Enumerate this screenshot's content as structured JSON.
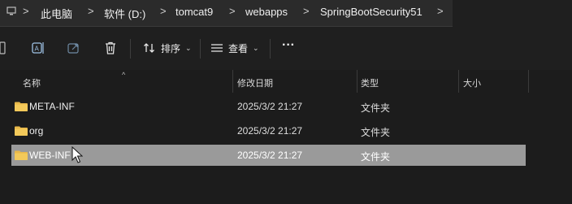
{
  "address": {
    "crumbs": [
      "此电脑",
      "软件 (D:)",
      "tomcat9",
      "webapps",
      "SpringBootSecurity51"
    ],
    "separator": ">"
  },
  "toolbar": {
    "sort_label": "排序",
    "view_label": "查看",
    "more_label": "···"
  },
  "columns": {
    "name": "名称",
    "modified": "修改日期",
    "type": "类型",
    "size": "大小"
  },
  "rows": [
    {
      "name": "META-INF",
      "date": "2025/3/2 21:27",
      "type": "文件夹",
      "selected": false
    },
    {
      "name": "org",
      "date": "2025/3/2 21:27",
      "type": "文件夹",
      "selected": false
    },
    {
      "name": "WEB-INF",
      "date": "2025/3/2 21:27",
      "type": "文件夹",
      "selected": true
    }
  ],
  "colors": {
    "folder": "#e8b84a",
    "selection": "#9a9a9a",
    "background": "#1c1c1c"
  }
}
